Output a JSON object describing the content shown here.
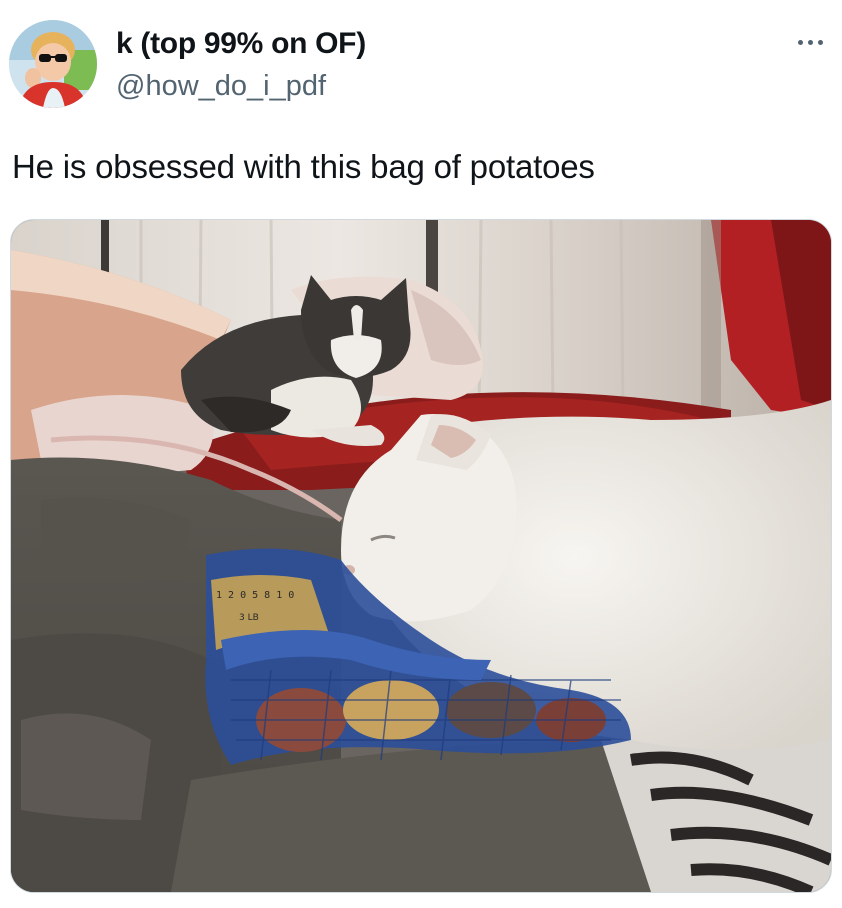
{
  "author": {
    "display_name": "k (top 99% on OF)",
    "handle": "@how_do_i_pdf",
    "avatar_icon": "profile-photo-toddler-sunglasses"
  },
  "menu": {
    "icon": "more-horizontal-icon"
  },
  "tweet": {
    "text": "He is obsessed with this bag of potatoes"
  },
  "media": {
    "subject": "photo of a white cat resting its head on a mesh bag of potatoes on a bed, tabby-and-white cat lying in background",
    "bag_label_texts": [
      "3 LB",
      "1 2 0 5 8 1 0"
    ]
  },
  "colors": {
    "text_primary": "#0f1419",
    "text_secondary": "#536471",
    "border": "#cfd9de"
  }
}
